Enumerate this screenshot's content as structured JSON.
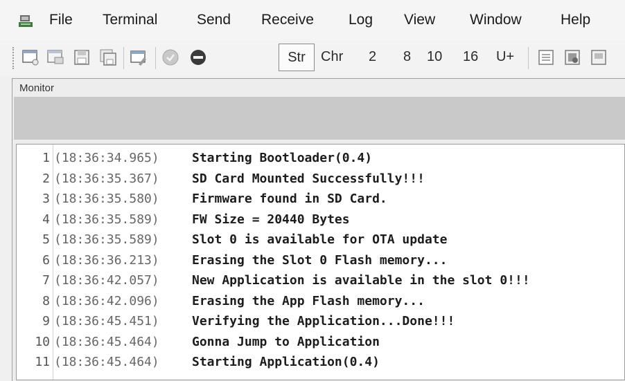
{
  "menu": {
    "items": [
      "File",
      "Terminal",
      "Send",
      "Receive",
      "Log",
      "View",
      "Window",
      "Help"
    ]
  },
  "toolbar": {
    "str_label": "Str",
    "chr_label": "Chr",
    "radix_2": "2",
    "radix_8": "8",
    "radix_10": "10",
    "radix_16": "16",
    "unicode_label": "U+"
  },
  "monitor": {
    "label": "Monitor",
    "lines": [
      {
        "n": "1",
        "time": "(18:36:34.965)",
        "text": "Starting Bootloader(0.4)"
      },
      {
        "n": "2",
        "time": "(18:36:35.367)",
        "text": "SD Card Mounted Successfully!!!"
      },
      {
        "n": "3",
        "time": "(18:36:35.580)",
        "text": "Firmware found in SD Card."
      },
      {
        "n": "4",
        "time": "(18:36:35.589)",
        "text": "FW Size = 20440 Bytes"
      },
      {
        "n": "5",
        "time": "(18:36:35.589)",
        "text": "Slot 0 is available for OTA update"
      },
      {
        "n": "6",
        "time": "(18:36:36.213)",
        "text": "Erasing the Slot 0 Flash memory..."
      },
      {
        "n": "7",
        "time": "(18:36:42.057)",
        "text": "New Application is available in the slot 0!!!"
      },
      {
        "n": "8",
        "time": "(18:36:42.096)",
        "text": "Erasing the App Flash memory..."
      },
      {
        "n": "9",
        "time": "(18:36:45.451)",
        "text": "Verifying the Application...Done!!!"
      },
      {
        "n": "10",
        "time": "(18:36:45.464)",
        "text": "Gonna Jump to Application"
      },
      {
        "n": "11",
        "time": "(18:36:45.464)",
        "text": "Starting Application(0.4)"
      }
    ]
  }
}
